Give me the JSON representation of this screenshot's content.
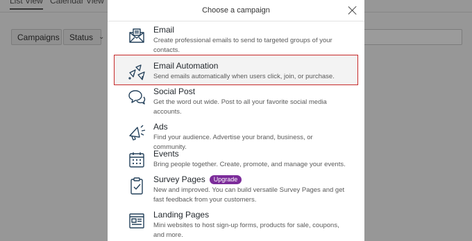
{
  "background": {
    "tabs": [
      "List View",
      "Calendar View"
    ],
    "filters": [
      "Campaigns",
      "Status"
    ]
  },
  "modal": {
    "title": "Choose a campaign",
    "options": [
      {
        "title": "Email",
        "desc": "Create professional emails to send to targeted groups of your contacts.",
        "icon": "envelope-icon"
      },
      {
        "title": "Email Automation",
        "desc": "Send emails automatically when users click, join, or purchase.",
        "icon": "paper-planes-icon"
      },
      {
        "title": "Social Post",
        "desc": "Get the word out wide. Post to all your favorite social media accounts.",
        "icon": "chat-bubbles-icon"
      },
      {
        "title": "Ads",
        "desc": "Find your audience. Advertise your brand, business, or community.",
        "icon": "megaphone-icon"
      },
      {
        "title": "Events",
        "desc": "Bring people together. Create, promote, and manage your events.",
        "icon": "calendar-icon"
      },
      {
        "title": "Survey Pages",
        "badge": "Upgrade",
        "desc": "New and improved. You can build versatile Survey Pages and get fast feedback from your customers.",
        "icon": "clipboard-check-icon"
      },
      {
        "title": "Landing Pages",
        "desc": "Mini websites to host sign-up forms, products for sale, coupons, and more.",
        "icon": "webpage-icon"
      }
    ]
  },
  "colors": {
    "selected_outline": "#c62828",
    "badge": "#7c2c9a"
  }
}
